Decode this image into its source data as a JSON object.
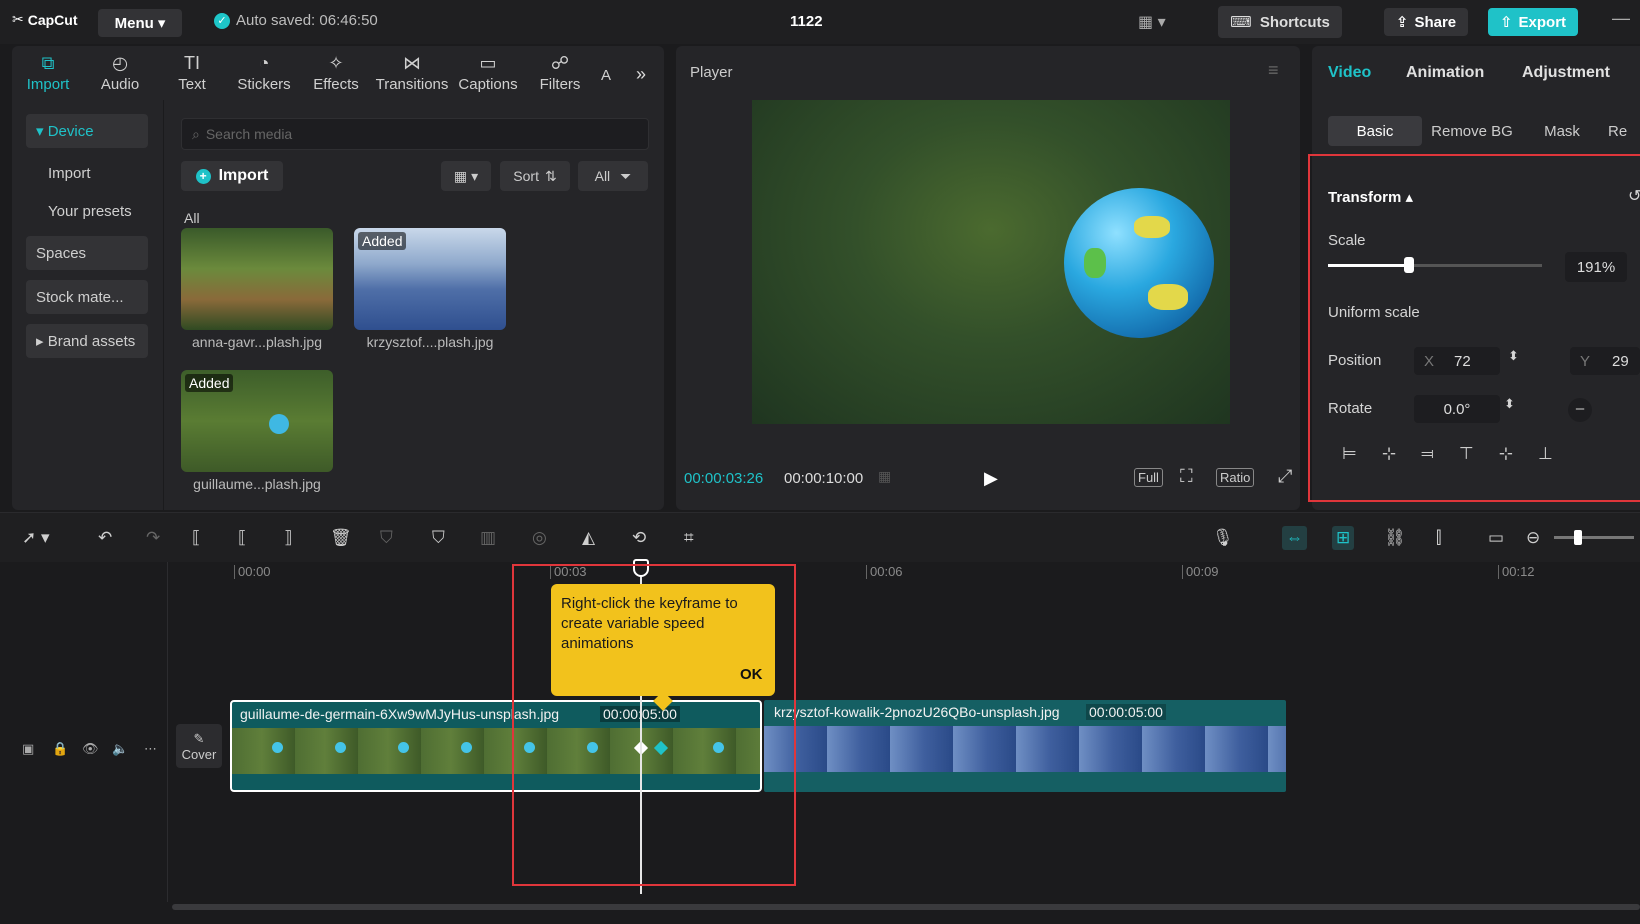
{
  "app": {
    "logo": "CapCut",
    "menu_label": "Menu",
    "autosave": "Auto saved: 06:46:50",
    "project_title": "1122",
    "shortcuts_label": "Shortcuts",
    "share_label": "Share",
    "export_label": "Export",
    "accent_color": "#1fc2c8"
  },
  "media_tools": [
    {
      "label": "Import",
      "icon": "import-icon"
    },
    {
      "label": "Audio",
      "icon": "audio-icon"
    },
    {
      "label": "Text",
      "icon": "text-icon"
    },
    {
      "label": "Stickers",
      "icon": "stickers-icon"
    },
    {
      "label": "Effects",
      "icon": "effects-icon"
    },
    {
      "label": "Transitions",
      "icon": "transitions-icon"
    },
    {
      "label": "Captions",
      "icon": "captions-icon"
    },
    {
      "label": "Filters",
      "icon": "filters-icon"
    },
    {
      "label": "A",
      "icon": "more-tools"
    }
  ],
  "sidebar": {
    "items": [
      "Device",
      "Import",
      "Your presets",
      "Spaces",
      "Stock mate...",
      "Brand assets"
    ]
  },
  "media": {
    "search_placeholder": "Search media",
    "import_label": "Import",
    "sort_label": "Sort",
    "filter_label": "All",
    "section_label": "All",
    "items": [
      {
        "name": "anna-gavr...plash.jpg",
        "badge": ""
      },
      {
        "name": "krzysztof....plash.jpg",
        "badge": "Added"
      },
      {
        "name": "guillaume...plash.jpg",
        "badge": "Added"
      }
    ]
  },
  "player": {
    "label": "Player",
    "current_time": "00:00:03:26",
    "total_time": "00:00:10:00",
    "full_label": "Full",
    "ratio_label": "Ratio"
  },
  "inspector": {
    "tabs": [
      "Video",
      "Animation",
      "Adjustment"
    ],
    "sub_tabs": [
      "Basic",
      "Remove BG",
      "Mask",
      "Re"
    ],
    "transform_label": "Transform",
    "scale_label": "Scale",
    "scale_value": "191%",
    "scale_fraction": 0.38,
    "uniform_scale_label": "Uniform scale",
    "position_label": "Position",
    "pos_x_label": "X",
    "pos_x": "72",
    "pos_y_label": "Y",
    "pos_y": "29",
    "rotate_label": "Rotate",
    "rotate_value": "0.0°"
  },
  "timeline": {
    "ruler": [
      "00:00",
      "00:03",
      "00:06",
      "00:09",
      "00:12"
    ],
    "cover_label": "Cover",
    "clips": [
      {
        "name": "guillaume-de-germain-6Xw9wMJyHus-unsplash.jpg",
        "duration": "00:00:05:00"
      },
      {
        "name": "krzysztof-kowalik-2pnozU26QBo-unsplash.jpg",
        "duration": "00:00:05:00"
      }
    ],
    "tooltip_text": "Right-click the keyframe to create variable speed animations",
    "tooltip_ok": "OK"
  }
}
